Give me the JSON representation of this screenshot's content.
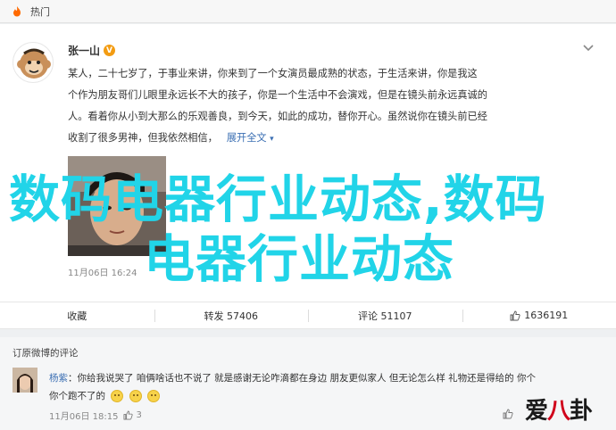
{
  "topbar": {
    "label": "热门",
    "icon": "fire-icon"
  },
  "post": {
    "author": "张一山",
    "verified_badge": "V",
    "lines": [
      "某人，二十七岁了，于事业来讲，你来到了一个女演员最成熟的状态，于生活来讲，你是我这",
      "个作为朋友哥们儿眼里永远长不大的孩子，你是一个生活中不会演戏，但是在镜头前永远真诚的",
      "人。看着你从小到大那么的乐观善良，到今天，如此的成功，替你开心。虽然说你在镜头前已经",
      "收割了很多男神，但我依然相信，"
    ],
    "expand_label": "展开全文",
    "expand_arrow": "▾",
    "time": "11月06日 16:24"
  },
  "watermark": {
    "line1": "数码电器行业动态,数码",
    "line2": "电器行业动态"
  },
  "actions": {
    "favorite": "收藏",
    "repost": "转发 57406",
    "comment": "评论 51107",
    "like": "1636191"
  },
  "comments": {
    "header": "订原微博的评论",
    "commenter": "杨紫",
    "text_line1": "：你给我说哭了 咱俩啥话也不说了 就是感谢无论咋滴都在身边 朋友更似家人 但无论怎么样 礼物还是得给的 你个",
    "text_line2": "你个跑不了的",
    "time": "11月06日 18:15",
    "like_count": "3"
  },
  "logo": {
    "part1": "爱",
    "part2": "八",
    "part3": "卦"
  },
  "colors": {
    "accent_link": "#3b6fb3",
    "watermark": "#21d4e8",
    "badge": "#f39c12"
  }
}
